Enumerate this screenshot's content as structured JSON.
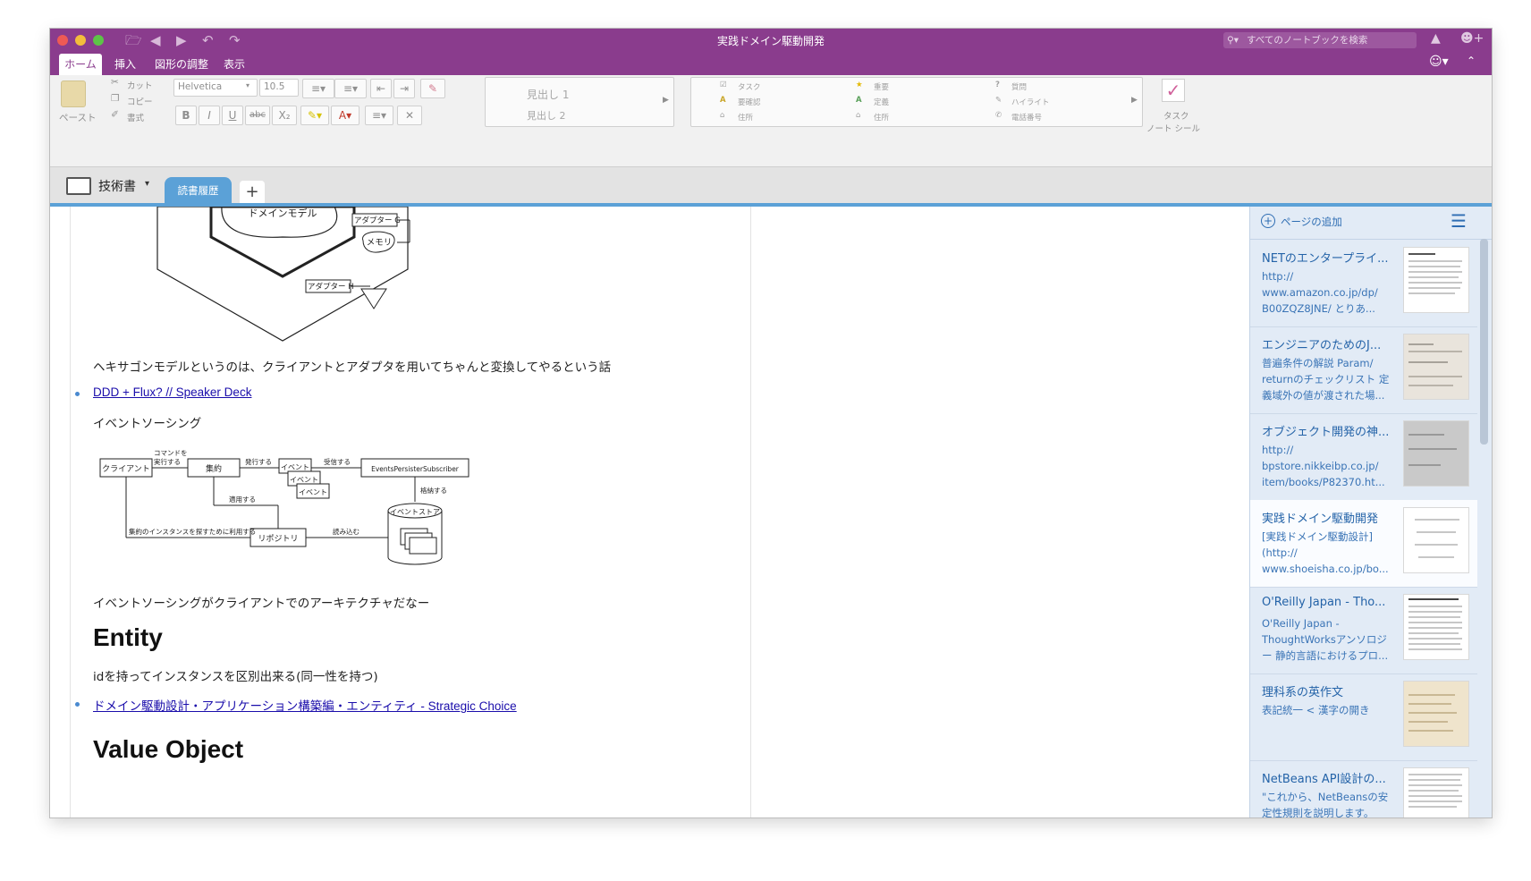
{
  "window": {
    "title": "実践ドメイン駆動開発"
  },
  "search": {
    "placeholder": "すべてのノートブックを検索"
  },
  "tabs": [
    "ホーム",
    "挿入",
    "図形の調整",
    "表示"
  ],
  "ribbon": {
    "paste": "ペースト",
    "cut": "カット",
    "copy": "コピー",
    "format": "書式",
    "font": "Helvetica",
    "size": "10.5",
    "bold": "B",
    "italic": "I",
    "underline": "U",
    "strike": "abc",
    "subscript": "X₂",
    "styles": [
      "見出し 1",
      "見出し 2"
    ],
    "tags": {
      "col1": [
        "タスク",
        "要確認",
        "住所"
      ],
      "col2": [
        "重要",
        "定義",
        "住所"
      ],
      "col3": [
        "質問",
        "ハイライト",
        "電話番号"
      ]
    },
    "task_label": "タスク",
    "task_sub": "ノート シール"
  },
  "notebook": {
    "name": "技術書",
    "section": "読書履歴",
    "add": "+"
  },
  "page": {
    "hex_labels": {
      "domain": "ドメインモデル",
      "adapterG": "アダプター G",
      "memory": "メモリ",
      "adapterH": "アダプター H"
    },
    "hex_text": "ヘキサゴンモデルというのは、クライアントとアダプタを用いてちゃんと変換してやるという話",
    "link1": "DDD + Flux? // Speaker Deck",
    "es_heading": "イベントソーシング",
    "es_diagram": {
      "client": "クライアント",
      "aggregate": "集約",
      "event": "イベント",
      "subscriber": "EventsPersisterSubscriber",
      "repository": "リポジトリ",
      "store": "イベントストア",
      "cmd1": "コマンドを",
      "cmd2": "実行する",
      "publish": "発行する",
      "receive": "受信する",
      "persist": "格納する",
      "apply": "適用する",
      "load": "読み込む",
      "use": "集約のインスタンスを探すために利用する"
    },
    "es_text": "イベントソーシングがクライアントでのアーキテクチャだなー",
    "entity_heading": "Entity",
    "entity_text": "idを持ってインスタンスを区別出来る(同一性を持つ)",
    "link2": "ドメイン駆動設計・アプリケーション構築編・エンティティ - Strategic Choice",
    "vo_heading": "Value Object"
  },
  "sidebar": {
    "add_page": "ページの追加",
    "items": [
      {
        "title": "NETのエンタープライ...",
        "body": "http://\nwww.amazon.co.jp/dp/\nB00ZQZ8JNE/  とりあ..."
      },
      {
        "title": "エンジニアのためのJ...",
        "body": "普遍条件の解説  Param/\nreturnのチェックリスト  定\n義域外の値が渡された場..."
      },
      {
        "title": "オブジェクト開発の神...",
        "body": "http://\nbpstore.nikkeibp.co.jp/\nitem/books/P82370.ht..."
      },
      {
        "title": "実践ドメイン駆動開発",
        "body": "[実践ドメイン駆動設計]\n(http://\nwww.shoeisha.co.jp/bo..."
      },
      {
        "title": "O'Reilly Japan - Tho...",
        "body": "O'Reilly Japan -\nThoughtWorksアンソロジ\nー  静的言語におけるプロ..."
      },
      {
        "title": "理科系の英作文",
        "body": "表記統一 < 漢字の開き"
      },
      {
        "title": "NetBeans API設計の...",
        "body": "\"これから、NetBeansの安\n定性規則を説明します。\nNetBeans、および、おそ..."
      }
    ]
  },
  "colors": {
    "titlebar": "#8a3c8d",
    "accent": "#5ba1d7",
    "link": "#1a0dab"
  }
}
